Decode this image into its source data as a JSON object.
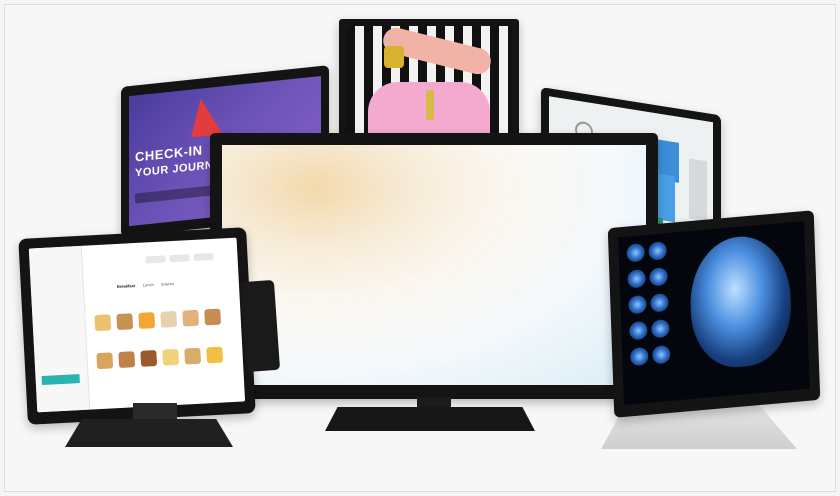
{
  "hero": {
    "accent_bezel": "#141414",
    "airline_screen": {
      "line1": "CHECK-IN",
      "line2": "YOUR JOURNEY BEGI"
    },
    "pos_screen": {
      "tabs": [
        "Breakfast",
        "Lunch",
        "Snacks"
      ],
      "active_tab": "Breakfast",
      "accent": "#2bb3b0"
    },
    "medical_screen": {
      "theme_color": "#2d6dc6"
    }
  }
}
